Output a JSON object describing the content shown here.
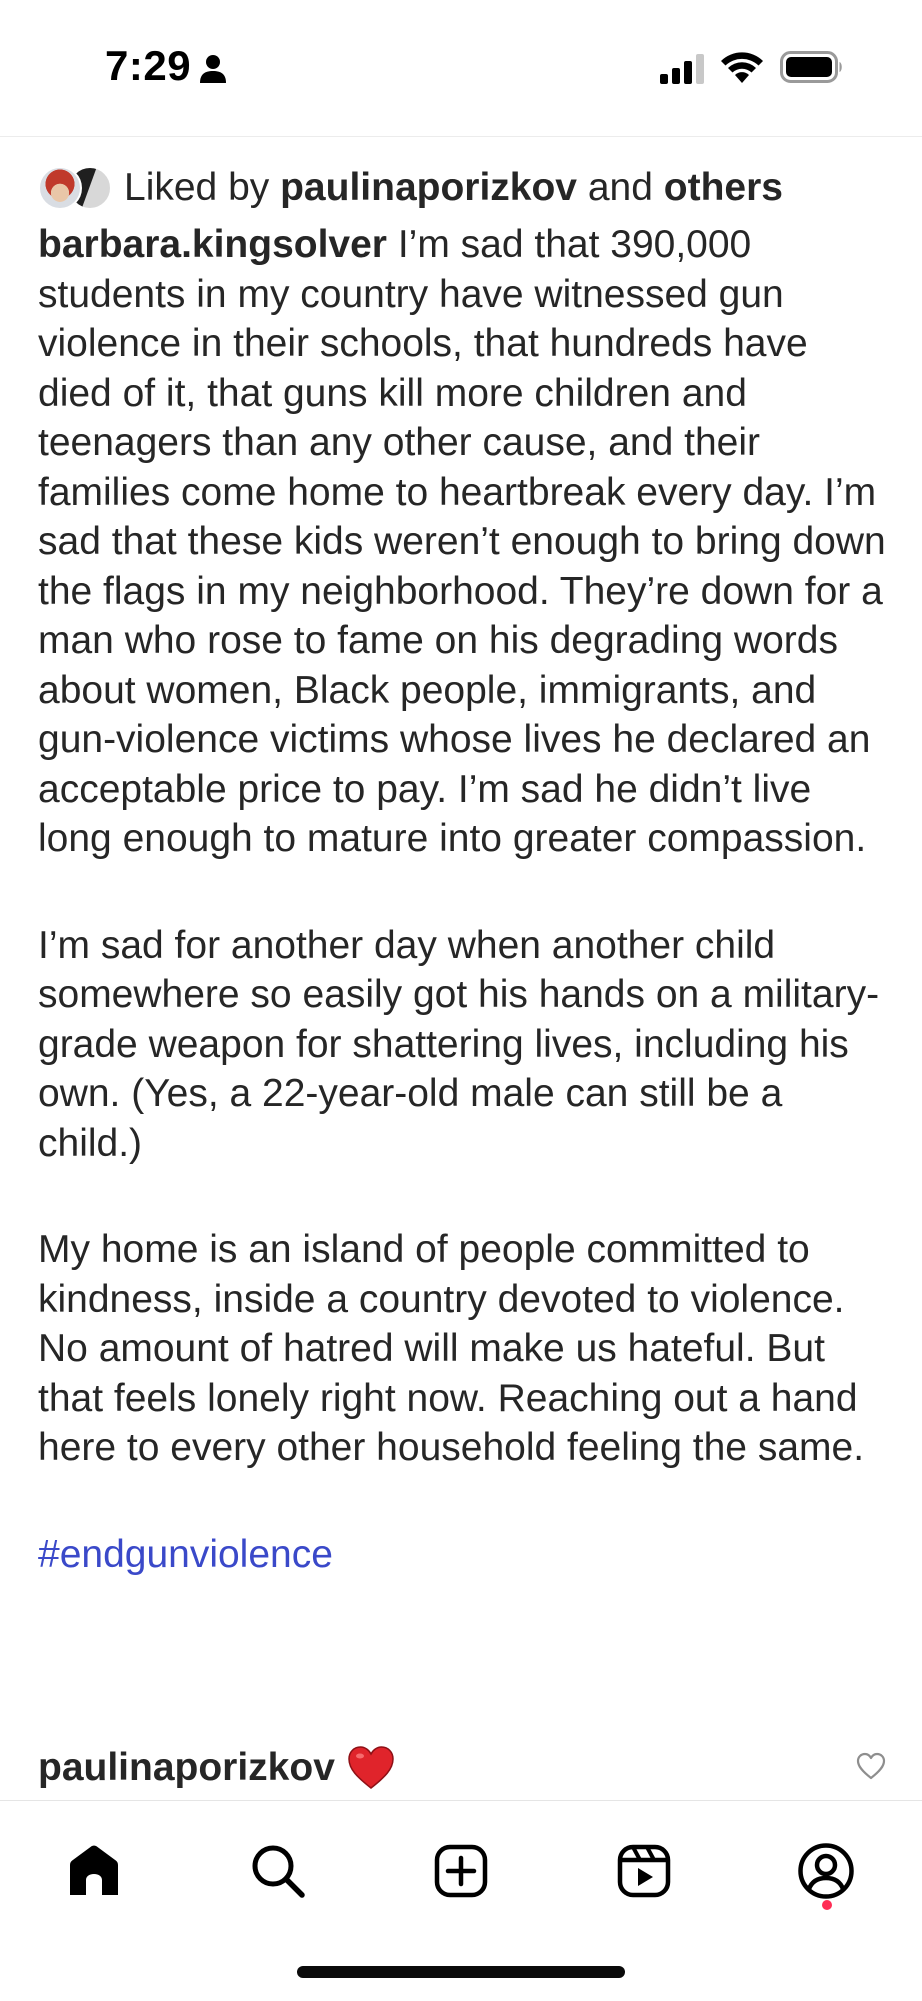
{
  "status_bar": {
    "time": "7:29",
    "icons": [
      "person-icon",
      "cellular-signal-icon",
      "wifi-icon",
      "battery-icon"
    ]
  },
  "post": {
    "likes": {
      "prefix": "Liked by",
      "user": "paulinaporizkov",
      "joiner": "and",
      "others": "others"
    },
    "caption": {
      "username": "barbara.kingsolver",
      "paragraphs": [
        "I’m sad that 390,000 students in my country have witnessed gun violence in their schools, that hundreds have died of it, that guns kill more children and teenagers than any other cause, and their families come home to heartbreak every day. I’m sad that these kids weren’t enough to bring down the flags in my neighborhood. They’re down for a man who rose to fame on his degrading words about women, Black people, immigrants, and gun-violence victims whose lives he declared an acceptable price to pay. I’m sad he didn’t live long enough to mature into greater compassion.",
        "I’m sad for another day when another child somewhere so easily got his hands on a military-grade weapon for shattering lives, including his own. (Yes, a 22-year-old male can still be a child.)",
        "My home is an island of people committed to kindness, inside a country devoted to violence. No amount of hatred will make us hateful. But that feels lonely right now. Reaching out a hand here to every other household feeling the same."
      ],
      "hashtag": "#endgunviolence"
    },
    "comment": {
      "username": "paulinaporizkov",
      "emoji": "red-heart-emoji"
    }
  },
  "tab_bar": {
    "tabs": [
      "home-icon",
      "search-icon",
      "create-post-icon",
      "reels-icon",
      "profile-icon"
    ],
    "active": "home-icon"
  },
  "colors": {
    "text": "#262626",
    "hashtag": "#3a49c9",
    "notification_dot": "#ff2d55",
    "heart": "#e0242b"
  }
}
